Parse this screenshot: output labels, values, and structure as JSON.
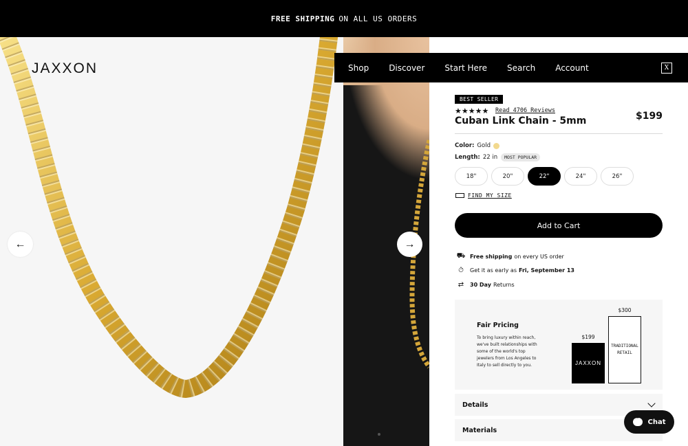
{
  "announcement": {
    "bold": "FREE SHIPPING",
    "rest": "ON ALL US ORDERS"
  },
  "brand": {
    "logo": "JAXXON"
  },
  "nav": {
    "items": [
      "Shop",
      "Discover",
      "Start Here",
      "Search",
      "Account"
    ],
    "cart_glyph": "X"
  },
  "gallery": {
    "prev_arrow": "←",
    "next_arrow": "→"
  },
  "product": {
    "badge": "BEST SELLER",
    "rating_stars": 5,
    "stars_glyph": "★★★★★",
    "reviews_link": "Read 4706 Reviews",
    "title": "Cuban Link Chain - 5mm",
    "price": "$199",
    "color_label": "Color:",
    "color_value": "Gold",
    "length_label": "Length:",
    "length_value": "22 in",
    "length_badge": "MOST POPULAR",
    "sizes": [
      "18\"",
      "20\"",
      "22\"",
      "24\"",
      "26\""
    ],
    "selected_size": "22\"",
    "find_size": "FIND MY SIZE",
    "add_to_cart": "Add to Cart"
  },
  "perks": {
    "shipping_bold": "Free shipping",
    "shipping_rest": "on every US order",
    "delivery_pre": "Get it as early as",
    "delivery_date": "Fri, September 13",
    "returns_bold": "30 Day",
    "returns_rest": "Returns"
  },
  "fair_pricing": {
    "title": "Fair Pricing",
    "text": "To bring luxury within reach, we've built relationships with some of the world's top jewelers from Los Angeles to Italy to sell directly to you.",
    "jaxxon_price": "$199",
    "jaxxon_label": "JAXXON",
    "retail_price": "$300",
    "retail_label": "TRADITIONAL RETAIL"
  },
  "accordions": [
    "Details",
    "Materials"
  ],
  "chat": {
    "label": "Chat"
  },
  "colors": {
    "accent": "#000000",
    "gold": "#f2d98e",
    "panel_bg": "#f6f6f6"
  }
}
